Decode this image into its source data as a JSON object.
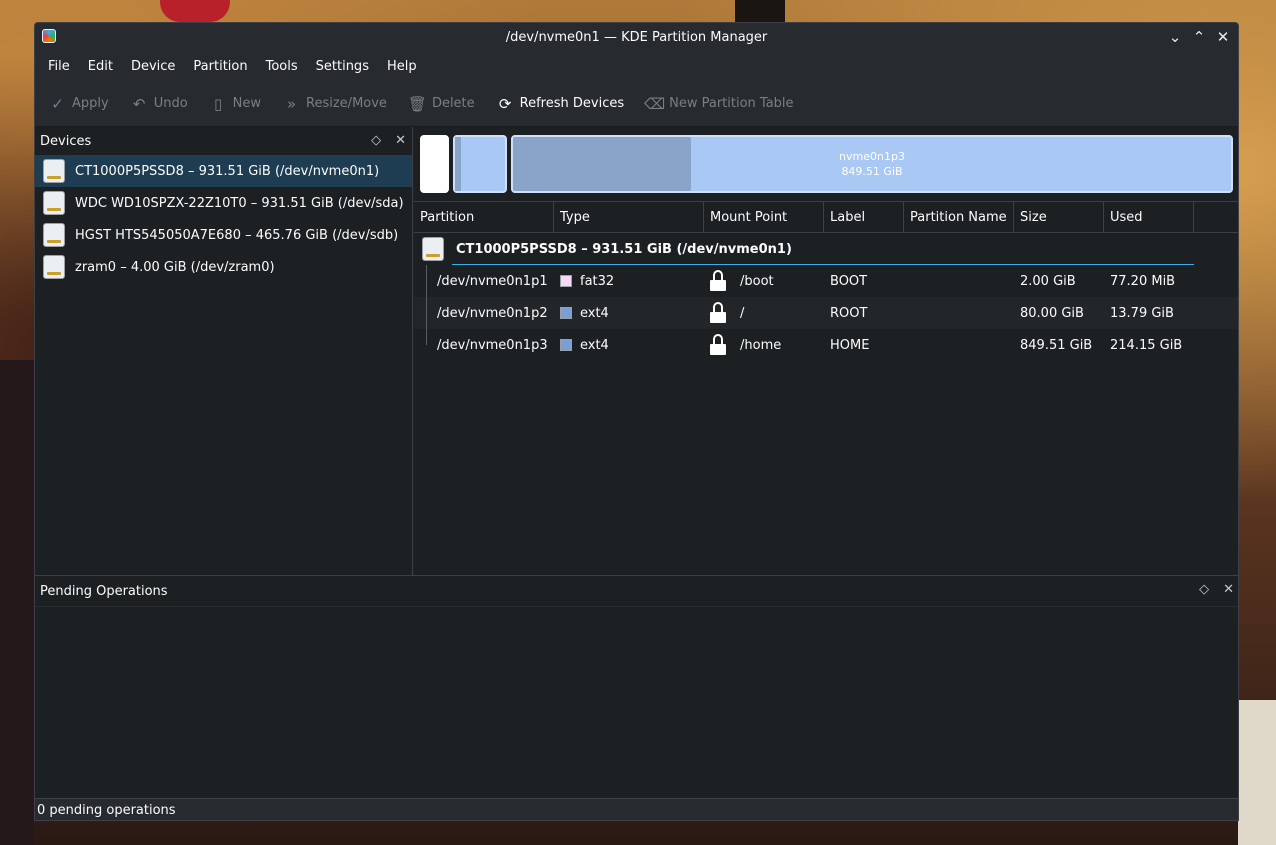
{
  "window": {
    "title": "/dev/nvme0n1 — KDE Partition Manager",
    "controls": [
      "minimize",
      "maximize",
      "close"
    ]
  },
  "menu": [
    "File",
    "Edit",
    "Device",
    "Partition",
    "Tools",
    "Settings",
    "Help"
  ],
  "toolbar": {
    "apply": "Apply",
    "undo": "Undo",
    "new": "New",
    "resize_move": "Resize/Move",
    "delete": "Delete",
    "refresh_devices": "Refresh Devices",
    "new_partition_table": "New Partition Table"
  },
  "devices_pane": {
    "title": "Devices",
    "items": [
      {
        "label": "CT1000P5PSSD8 – 931.51 GiB (/dev/nvme0n1)",
        "selected": true
      },
      {
        "label": "WDC WD10SPZX-22Z10T0 – 931.51 GiB (/dev/sda)",
        "selected": false
      },
      {
        "label": "HGST HTS545050A7E680 – 465.76 GiB (/dev/sdb)",
        "selected": false
      },
      {
        "label": "zram0 – 4.00 GiB (/dev/zram0)",
        "selected": false
      }
    ]
  },
  "partition_bar": {
    "largest_label_name": "nvme0n1p3",
    "largest_label_size": "849.51 GiB"
  },
  "table": {
    "headers": [
      "Partition",
      "Type",
      "Mount Point",
      "Label",
      "Partition Name",
      "Size",
      "Used"
    ],
    "device_row": "CT1000P5PSSD8 – 931.51 GiB (/dev/nvme0n1)",
    "rows": [
      {
        "partition": "/dev/nvme0n1p1",
        "type": "fat32",
        "type_color": "#f7d9f3",
        "mount": "/boot",
        "label": "BOOT",
        "name": "",
        "size": "2.00 GiB",
        "used": "77.20 MiB"
      },
      {
        "partition": "/dev/nvme0n1p2",
        "type": "ext4",
        "type_color": "#7a9fd6",
        "mount": "/",
        "label": "ROOT",
        "name": "",
        "size": "80.00 GiB",
        "used": "13.79 GiB"
      },
      {
        "partition": "/dev/nvme0n1p3",
        "type": "ext4",
        "type_color": "#7a9fd6",
        "mount": "/home",
        "label": "HOME",
        "name": "",
        "size": "849.51 GiB",
        "used": "214.15 GiB"
      }
    ]
  },
  "pending": {
    "title": "Pending Operations",
    "status": "0 pending operations"
  }
}
